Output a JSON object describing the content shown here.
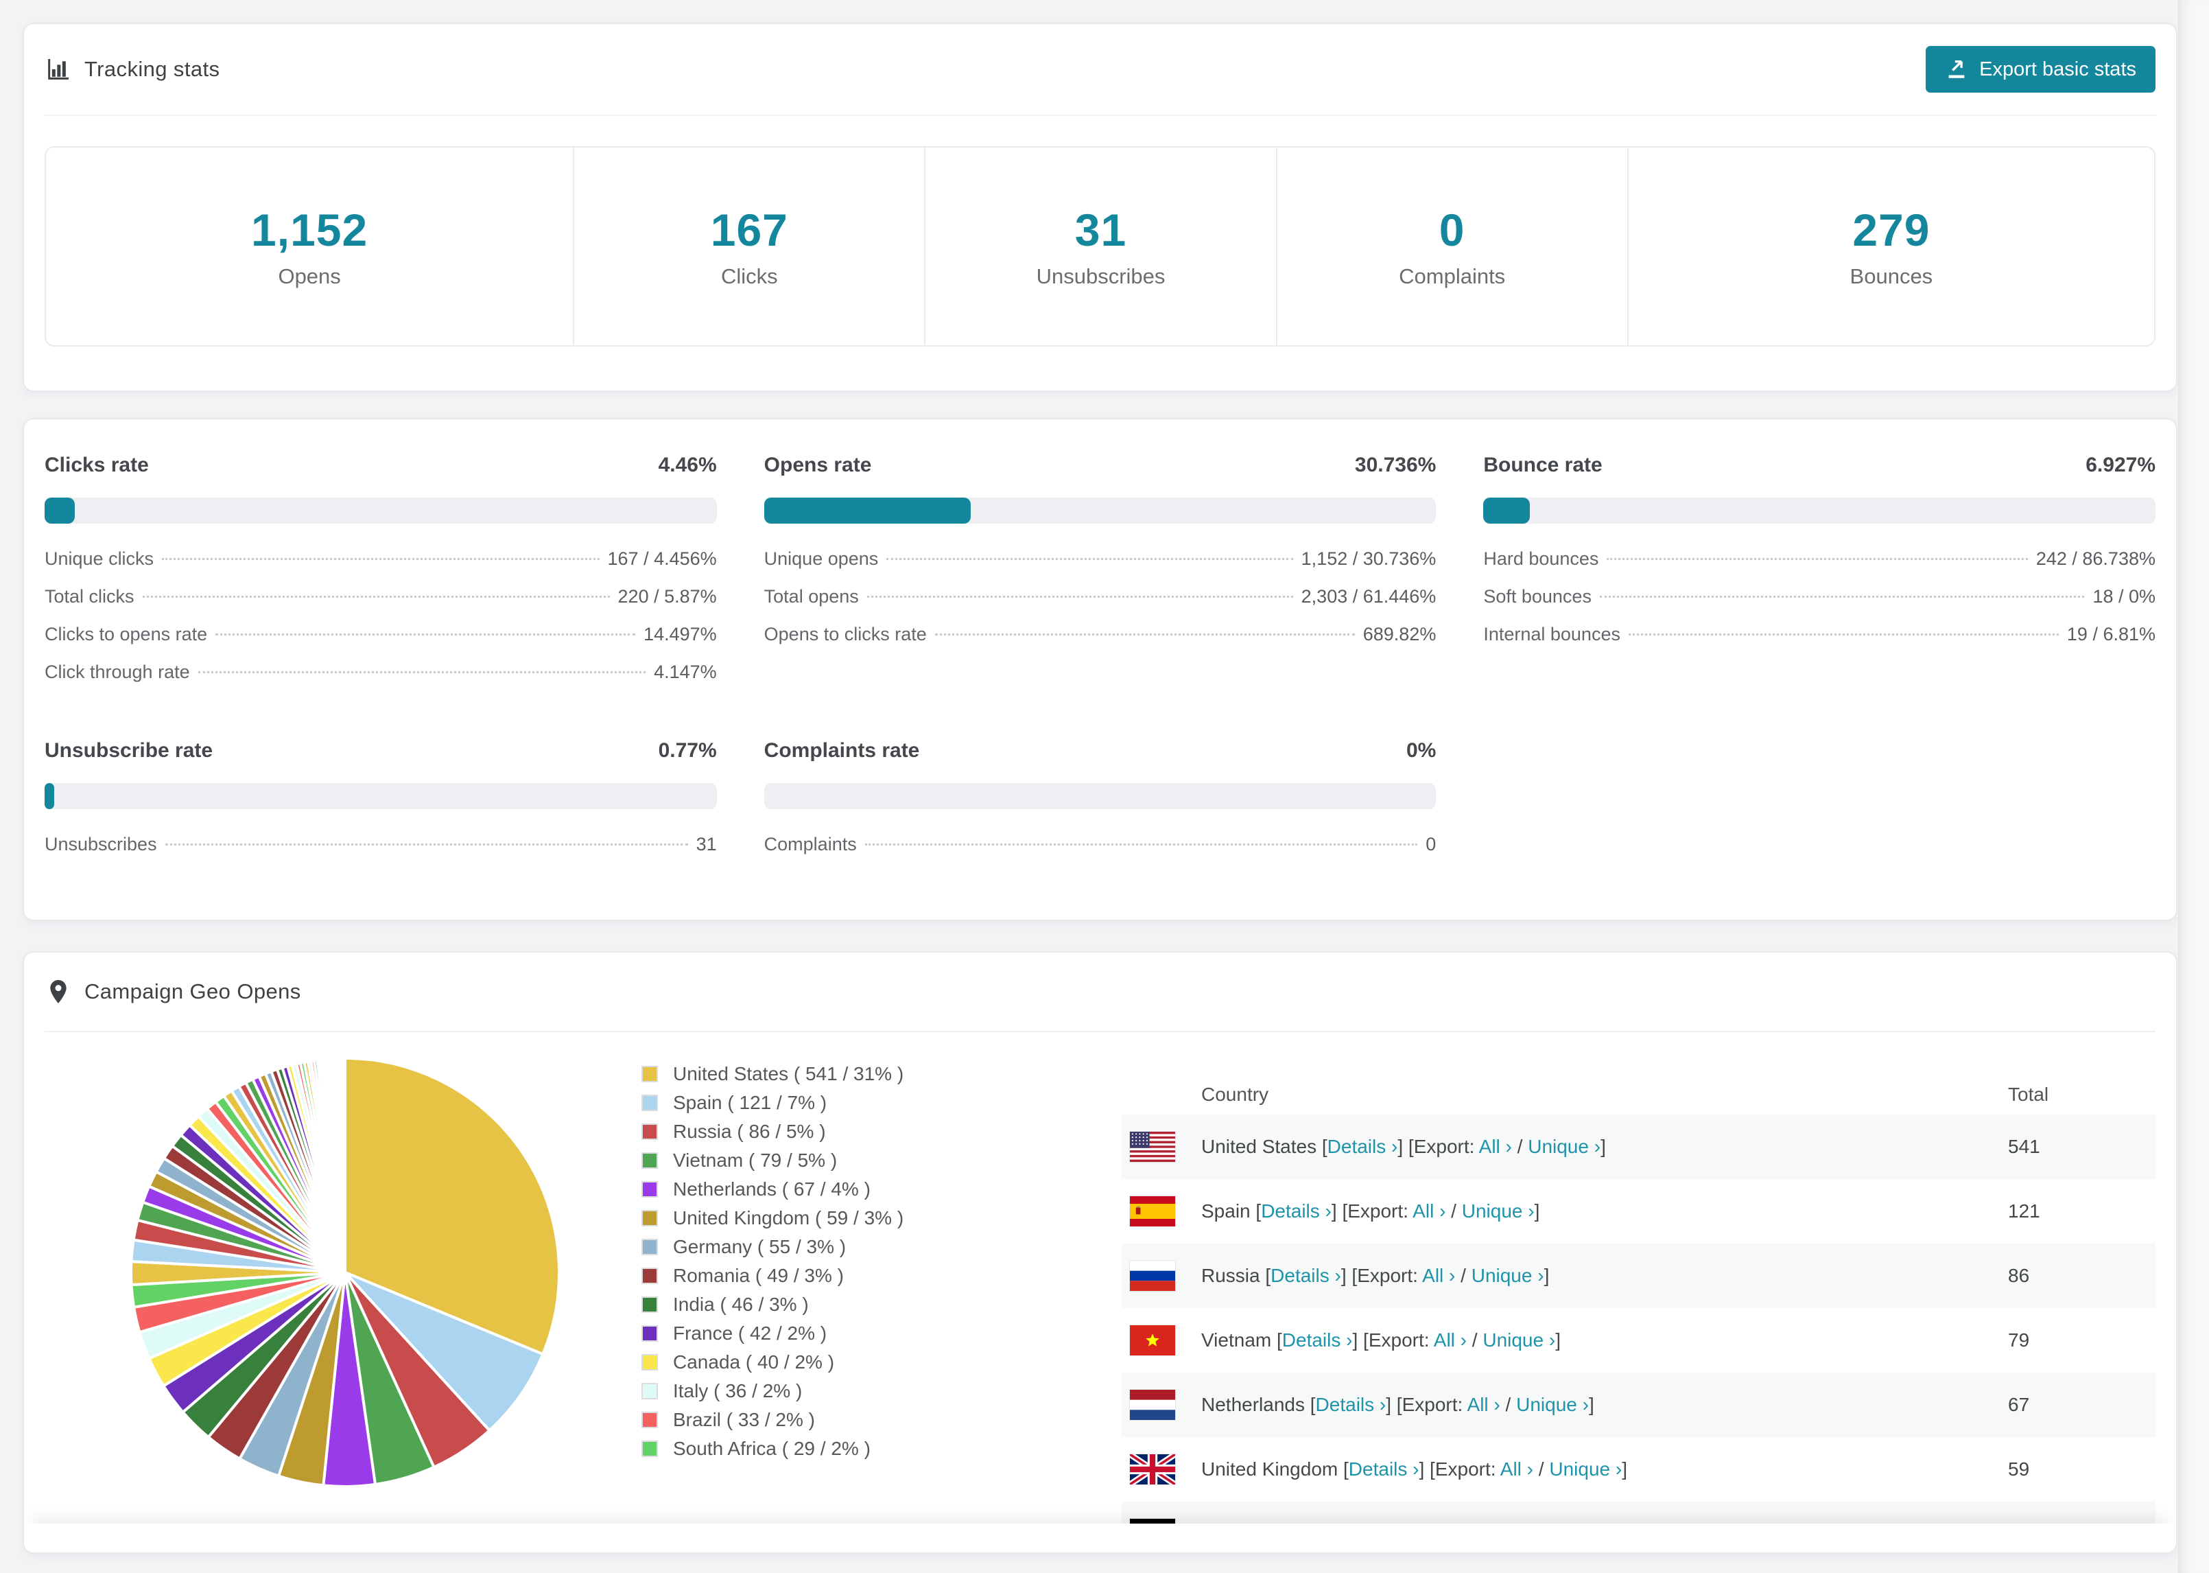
{
  "theme": {
    "accent": "#15879D",
    "link": "#1E93A9",
    "page_bg": "#F2F3F5"
  },
  "tracking": {
    "title": "Tracking stats",
    "export_button": "Export basic stats",
    "stats": [
      {
        "value": "1,152",
        "label": "Opens"
      },
      {
        "value": "167",
        "label": "Clicks"
      },
      {
        "value": "31",
        "label": "Unsubscribes"
      },
      {
        "value": "0",
        "label": "Complaints"
      },
      {
        "value": "279",
        "label": "Bounces"
      }
    ]
  },
  "rates": [
    {
      "title": "Clicks rate",
      "value": "4.46%",
      "percent": 4.46,
      "rows": [
        [
          "Unique clicks",
          "167 / 4.456%"
        ],
        [
          "Total clicks",
          "220 / 5.87%"
        ],
        [
          "Clicks to opens rate",
          "14.497%"
        ],
        [
          "Click through rate",
          "4.147%"
        ]
      ]
    },
    {
      "title": "Opens rate",
      "value": "30.736%",
      "percent": 30.736,
      "rows": [
        [
          "Unique opens",
          "1,152 / 30.736%"
        ],
        [
          "Total opens",
          "2,303 / 61.446%"
        ],
        [
          "Opens to clicks rate",
          "689.82%"
        ]
      ]
    },
    {
      "title": "Bounce rate",
      "value": "6.927%",
      "percent": 6.927,
      "rows": [
        [
          "Hard bounces",
          "242 / 86.738%"
        ],
        [
          "Soft bounces",
          "18 / 0%"
        ],
        [
          "Internal bounces",
          "19 / 6.81%"
        ]
      ]
    },
    {
      "title": "Unsubscribe rate",
      "value": "0.77%",
      "percent": 0.77,
      "rows": [
        [
          "Unsubscribes",
          "31"
        ]
      ]
    },
    {
      "title": "Complaints rate",
      "value": "0%",
      "percent": 0,
      "rows": [
        [
          "Complaints",
          "0"
        ]
      ]
    }
  ],
  "geo": {
    "title": "Campaign Geo Opens",
    "table_headers": [
      "Country",
      "Total"
    ],
    "row_links": {
      "open_bracket": "[",
      "details": "Details ›",
      "close_open": "] [Export: ",
      "all": "All ›",
      "slash": " / ",
      "unique": "Unique ›",
      "close": "]"
    },
    "visible_table_rows": 7,
    "countries": [
      {
        "name": "United States",
        "flag": "us",
        "opens": 541,
        "pct": 31
      },
      {
        "name": "Spain",
        "flag": "es",
        "opens": 121,
        "pct": 7
      },
      {
        "name": "Russia",
        "flag": "ru",
        "opens": 86,
        "pct": 5
      },
      {
        "name": "Vietnam",
        "flag": "vn",
        "opens": 79,
        "pct": 5
      },
      {
        "name": "Netherlands",
        "flag": "nl",
        "opens": 67,
        "pct": 4
      },
      {
        "name": "United Kingdom",
        "flag": "gb",
        "opens": 59,
        "pct": 3
      },
      {
        "name": "Germany",
        "flag": "de",
        "opens": 55,
        "pct": 3
      },
      {
        "name": "Romania",
        "flag": "ro",
        "opens": 49,
        "pct": 3
      },
      {
        "name": "India",
        "flag": "in",
        "opens": 46,
        "pct": 3
      },
      {
        "name": "France",
        "flag": "fr",
        "opens": 42,
        "pct": 2
      },
      {
        "name": "Canada",
        "flag": "ca",
        "opens": 40,
        "pct": 2
      },
      {
        "name": "Italy",
        "flag": "it",
        "opens": 36,
        "pct": 2
      },
      {
        "name": "Brazil",
        "flag": "br",
        "opens": 33,
        "pct": 2
      },
      {
        "name": "South Africa",
        "flag": "za",
        "opens": 29,
        "pct": 2
      }
    ],
    "chart_data": {
      "type": "pie",
      "title": "Campaign Geo Opens",
      "categories": [
        "United States",
        "Spain",
        "Russia",
        "Vietnam",
        "Netherlands",
        "United Kingdom",
        "Germany",
        "Romania",
        "India",
        "France",
        "Canada",
        "Italy",
        "Brazil",
        "South Africa"
      ],
      "values": [
        541,
        121,
        86,
        79,
        67,
        59,
        55,
        49,
        46,
        42,
        40,
        36,
        33,
        29
      ],
      "percent_labels": [
        31,
        7,
        5,
        5,
        4,
        3,
        3,
        3,
        3,
        2,
        2,
        2,
        2,
        2
      ],
      "other_slices_approx": [
        30,
        28,
        26,
        24,
        22,
        21,
        20,
        19,
        18,
        17,
        16,
        15,
        14,
        13,
        12,
        11,
        10,
        10,
        9,
        9,
        8,
        8,
        7,
        7,
        6,
        6,
        5,
        5,
        5,
        4,
        4,
        4,
        3,
        3,
        3,
        3,
        2,
        2,
        2,
        2,
        2,
        2,
        1,
        1,
        1,
        1,
        1,
        1,
        1,
        1,
        1,
        1,
        1,
        1
      ],
      "colors": [
        "#E6C345",
        "#ABD4F0",
        "#C84C4C",
        "#4FA551",
        "#9A3BEA",
        "#BE9B2F",
        "#8FB2CD",
        "#9C3A3A",
        "#38813C",
        "#6C30BC",
        "#F9E74B",
        "#DEFBF7",
        "#F56060",
        "#62D166"
      ],
      "legend_position": "right",
      "start_angle_deg": 0,
      "direction": "clockwise"
    }
  }
}
